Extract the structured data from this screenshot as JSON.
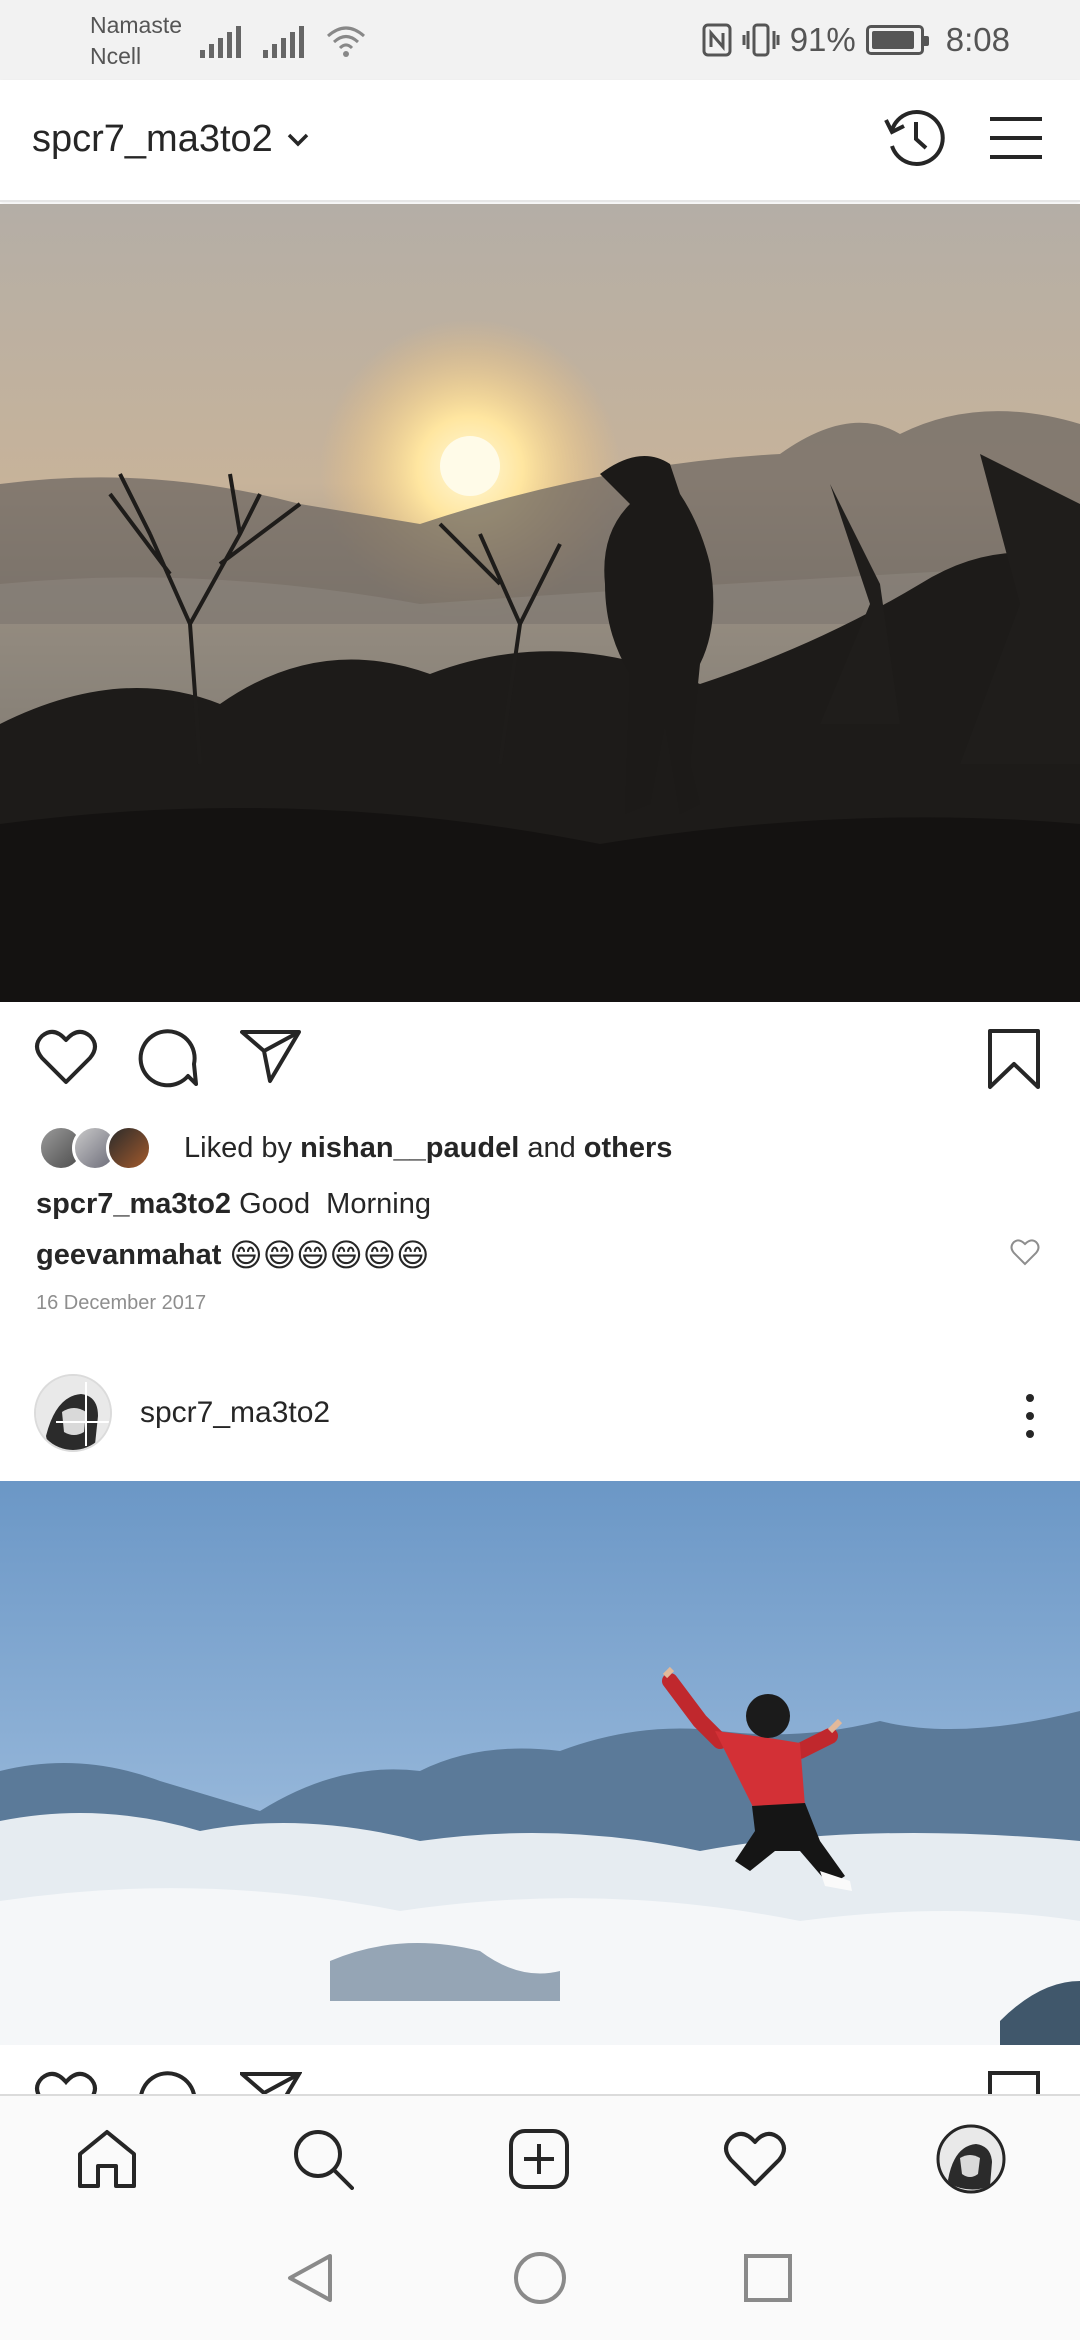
{
  "status_bar": {
    "carrier_line1": "Namaste",
    "carrier_line2": "Ncell",
    "battery_percent": "91%",
    "battery_level": 0.91,
    "time": "8:08",
    "icons": [
      "signal-icon",
      "signal-icon",
      "wifi-icon",
      "nfc-icon",
      "vibrate-icon",
      "battery-icon"
    ]
  },
  "header": {
    "username": "spcr7_ma3to2",
    "icons": [
      "chevron-down-icon",
      "history-icon",
      "menu-icon"
    ]
  },
  "post1": {
    "likes_prefix": "Liked by",
    "liked_by_user": "nishan__paudel",
    "likes_and": "and",
    "likes_others": "others",
    "caption_user": "spcr7_ma3to2",
    "caption_text": "Good  Morning",
    "comment_user": "geevanmahat",
    "comment_text": "😄😄😄😄😄😄",
    "date": "16 December 2017",
    "icons": [
      "heart-icon",
      "comment-icon",
      "share-icon",
      "bookmark-icon"
    ]
  },
  "post2": {
    "username": "spcr7_ma3to2",
    "icons": [
      "more-options-icon"
    ]
  },
  "bottom_nav": {
    "items": [
      "home-icon",
      "search-icon",
      "add-post-icon",
      "activity-heart-icon",
      "profile-avatar"
    ]
  },
  "system_nav": {
    "items": [
      "back-icon",
      "home-circle-icon",
      "recents-icon"
    ]
  }
}
